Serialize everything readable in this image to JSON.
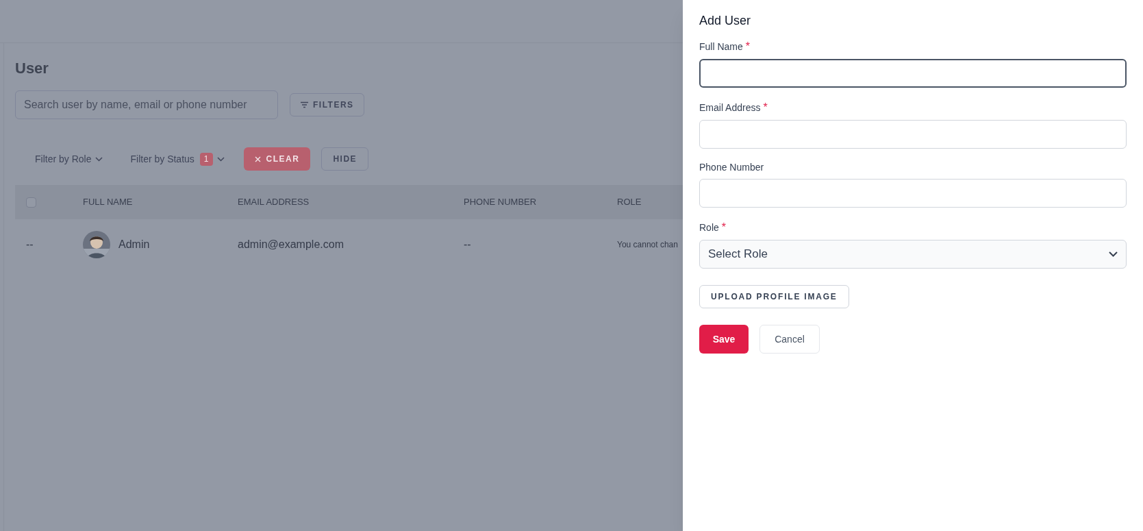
{
  "page": {
    "title": "User",
    "search": {
      "placeholder": "Search user by name, email or phone number"
    },
    "filters_button": "FILTERS",
    "filter_bar": [
      {
        "label": "Filter by Role"
      },
      {
        "label": "Filter by Status",
        "count": "1"
      }
    ],
    "clear_button": "CLEAR",
    "hide_button": "HIDE",
    "table": {
      "select_all_checked": false,
      "columns": [
        "FULL NAME",
        "EMAIL ADDRESS",
        "PHONE NUMBER",
        "ROLE"
      ],
      "rows": [
        {
          "column_0": "--",
          "name": "Admin",
          "email": "admin@example.com",
          "phone": "--",
          "role": "You cannot chan"
        }
      ]
    }
  },
  "drawer": {
    "title": "Add User",
    "fields": [
      {
        "kind": "text",
        "label": "Full Name",
        "required_mark": "*",
        "focused": true
      },
      {
        "kind": "text",
        "label": "Email Address",
        "required_mark": "*",
        "focused": false
      },
      {
        "kind": "text",
        "label": "Phone Number",
        "focused": false
      },
      {
        "kind": "select",
        "label": "Role",
        "required_mark": "*",
        "focused": false,
        "value": "Select Role"
      }
    ],
    "upload_button": "UPLOAD PROFILE IMAGE",
    "save_button": "Save",
    "cancel_button": "Cancel"
  }
}
